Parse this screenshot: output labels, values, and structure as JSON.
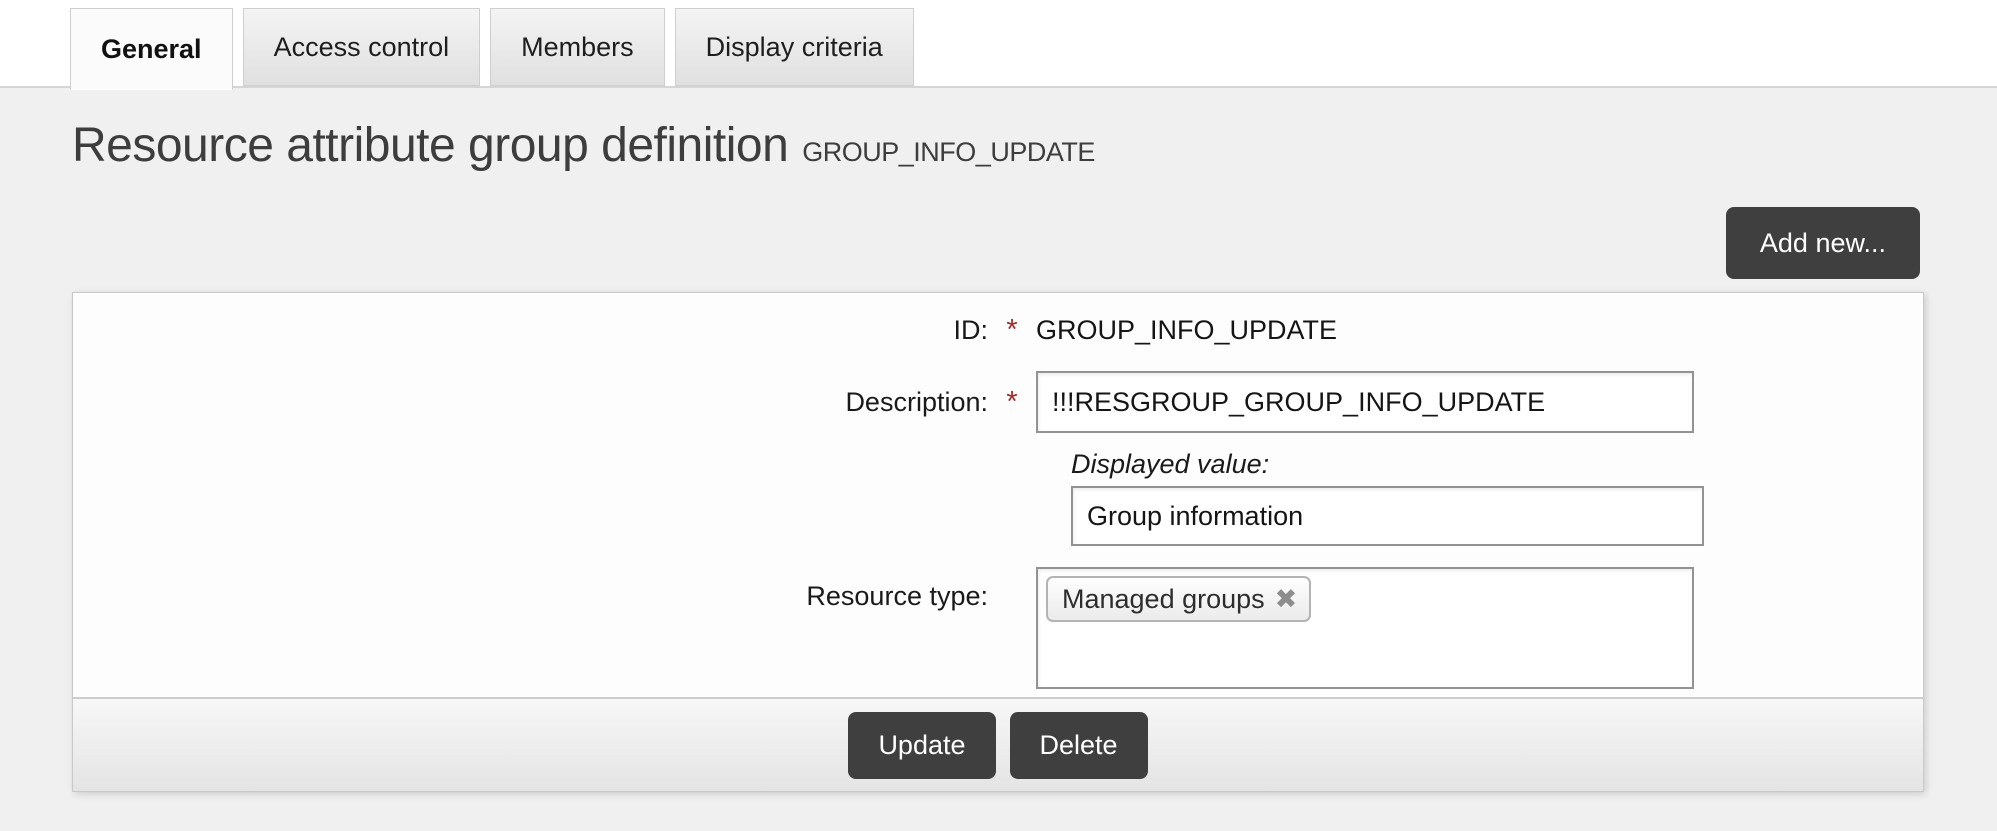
{
  "tabs": [
    {
      "label": "General",
      "active": true
    },
    {
      "label": "Access control",
      "active": false
    },
    {
      "label": "Members",
      "active": false
    },
    {
      "label": "Display criteria",
      "active": false
    }
  ],
  "page": {
    "title": "Resource attribute group definition",
    "subtitle": "GROUP_INFO_UPDATE"
  },
  "toolbar": {
    "add_new_label": "Add new..."
  },
  "form": {
    "id_field": {
      "label": "ID:",
      "required_marker": "*",
      "value": "GROUP_INFO_UPDATE"
    },
    "description_field": {
      "label": "Description:",
      "required_marker": "*",
      "value": "!!!RESGROUP_GROUP_INFO_UPDATE"
    },
    "displayed_value_field": {
      "label": "Displayed value:",
      "value": "Group information"
    },
    "resource_type_field": {
      "label": "Resource type:",
      "tags": [
        {
          "label": "Managed groups",
          "remove_icon": "✖"
        }
      ]
    }
  },
  "actions": {
    "update_label": "Update",
    "delete_label": "Delete"
  },
  "colors": {
    "accent_dark": "#3f3f3f",
    "required_red": "#a02929",
    "page_bg": "#f0f0f0",
    "panel_bg": "#fdfdfd"
  }
}
